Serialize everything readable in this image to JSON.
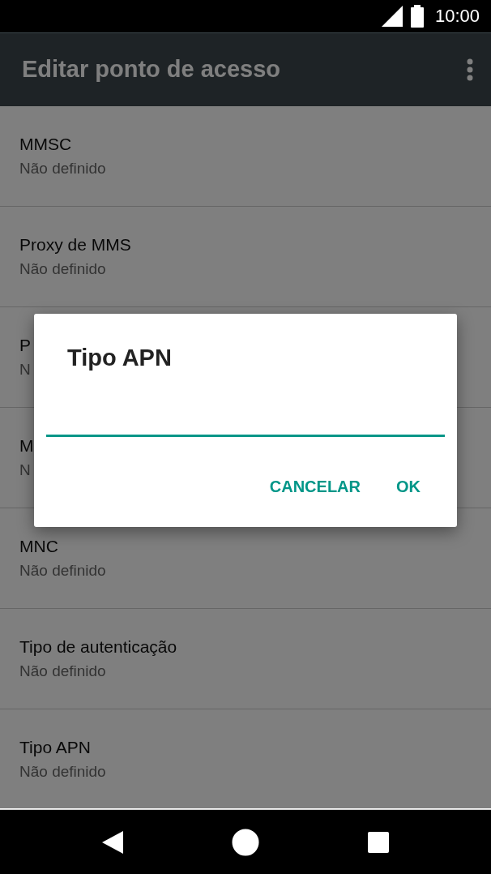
{
  "status_bar": {
    "time": "10:00"
  },
  "app_bar": {
    "title": "Editar ponto de acesso"
  },
  "settings": [
    {
      "title": "MMSC",
      "value": "Não definido"
    },
    {
      "title": "Proxy de MMS",
      "value": "Não definido"
    },
    {
      "title": "P",
      "value": "N"
    },
    {
      "title": "M",
      "value": "N"
    },
    {
      "title": "MNC",
      "value": "Não definido"
    },
    {
      "title": "Tipo de autenticação",
      "value": "Não definido"
    },
    {
      "title": "Tipo APN",
      "value": "Não definido"
    }
  ],
  "dialog": {
    "title": "Tipo APN",
    "buttons": [
      "CANCELAR",
      "OK"
    ]
  }
}
